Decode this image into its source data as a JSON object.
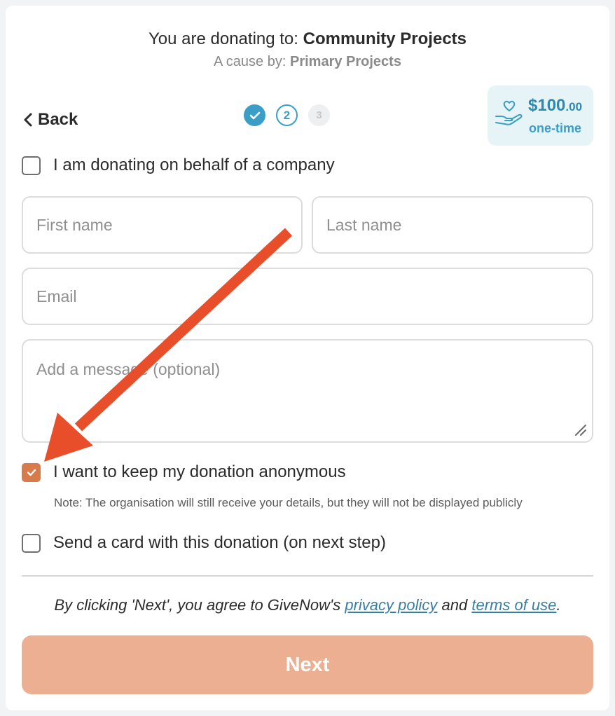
{
  "header": {
    "donating_to_prefix": "You are donating to: ",
    "donating_to_name": "Community Projects",
    "cause_by_prefix": "A cause by: ",
    "cause_by_name": "Primary Projects"
  },
  "nav": {
    "back_label": "Back"
  },
  "steps": [
    {
      "label": "",
      "state": "done"
    },
    {
      "label": "2",
      "state": "current"
    },
    {
      "label": "3",
      "state": "todo"
    }
  ],
  "amount": {
    "currency_whole": "$100",
    "cents": ".00",
    "frequency": "one-time",
    "icon": "heart-hand-icon"
  },
  "form": {
    "company_checkbox_label": "I am donating on behalf of a company",
    "company_checked": false,
    "first_name_placeholder": "First name",
    "last_name_placeholder": "Last name",
    "email_placeholder": "Email",
    "message_placeholder": "Add a message (optional)",
    "anonymous_checkbox_label": "I want to keep my donation anonymous",
    "anonymous_checked": true,
    "anonymous_note": "Note: The organisation will still receive your details, but they will not be displayed publicly",
    "card_checkbox_label": "Send a card with this donation (on next step)",
    "card_checked": false
  },
  "legal": {
    "prefix": "By clicking 'Next', you agree to GiveNow's ",
    "privacy_link": "privacy policy",
    "middle": " and ",
    "terms_link": "terms of use",
    "suffix": "."
  },
  "next_button": {
    "label": "Next"
  },
  "colors": {
    "accent_blue": "#3b9ec7",
    "checkbox_orange": "#d97a4a",
    "next_button": "#ecaf91",
    "annotation_arrow": "#e94e2a"
  }
}
